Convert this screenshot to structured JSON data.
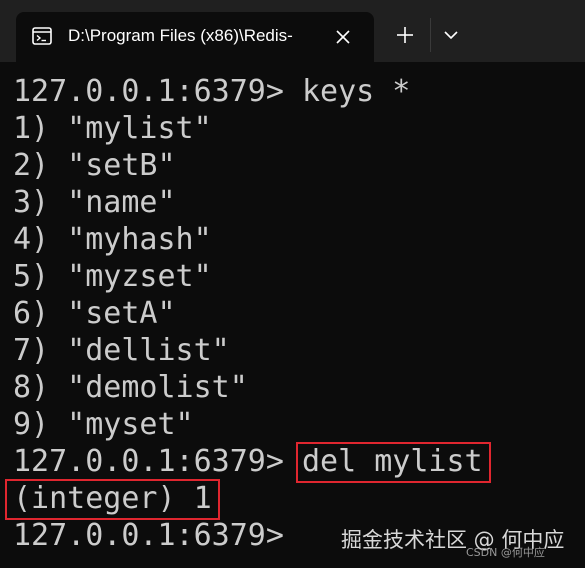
{
  "tab": {
    "title": "D:\\Program Files (x86)\\Redis-",
    "icon": "terminal-icon"
  },
  "toolbar": {
    "new_tab_icon": "plus-icon",
    "dropdown_icon": "chevron-down-icon",
    "close_icon": "close-icon"
  },
  "terminal": {
    "prompt": "127.0.0.1:6379> ",
    "prompt_bare": "127.0.0.1:6379>",
    "command_1": "keys *",
    "results": [
      "1) \"mylist\"",
      "2) \"setB\"",
      "3) \"name\"",
      "4) \"myhash\"",
      "5) \"myzset\"",
      "6) \"setA\"",
      "7) \"dellist\"",
      "8) \"demolist\"",
      "9) \"myset\""
    ],
    "command_2": "del mylist",
    "integer_result": "(integer) 1"
  },
  "watermark": {
    "main": "掘金技术社区 @ 何中应",
    "sub": "CSDN @何中应"
  },
  "colors": {
    "background": "#0c0c0c",
    "tabbar": "#202020",
    "text": "#cccccc",
    "highlight_border": "#e0262f"
  }
}
